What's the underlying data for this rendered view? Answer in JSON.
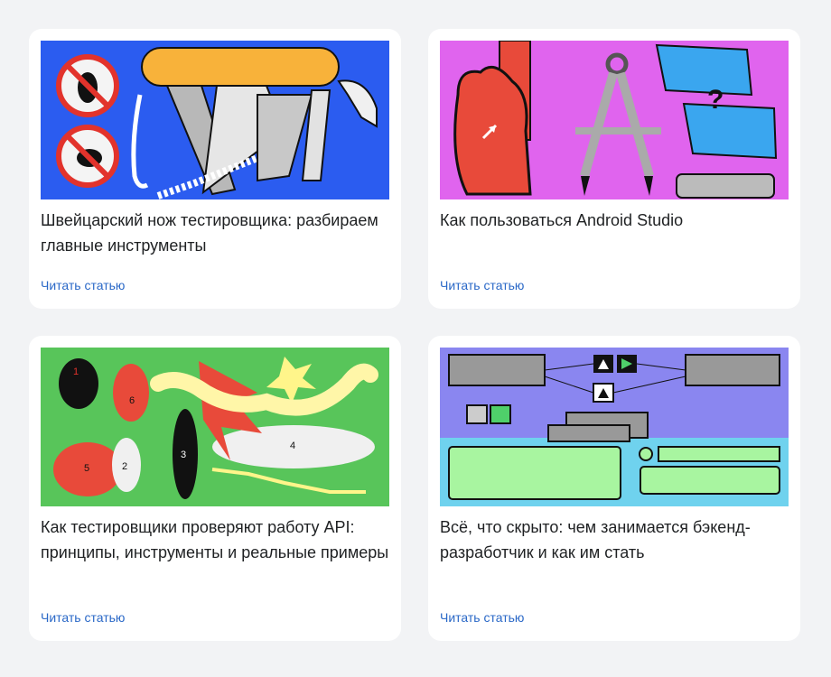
{
  "cards": [
    {
      "title": "Швейцарский нож тестировщика: разбираем главные инструменты",
      "link": "Читать статью",
      "image": "swiss-knife-illustration"
    },
    {
      "title": "Как пользоваться Android Studio",
      "link": "Читать статью",
      "image": "android-studio-illustration"
    },
    {
      "title": "Как тестировщики проверяют работу API: принципы, инструменты и реальные примеры",
      "link": "Читать статью",
      "image": "api-testing-illustration"
    },
    {
      "title": "Всё, что скрыто: чем занимается бэкенд-разработчик и как им стать",
      "link": "Читать статью",
      "image": "backend-developer-illustration"
    }
  ],
  "illustration_labels": {
    "api": [
      "1",
      "2",
      "3",
      "4",
      "5",
      "6"
    ],
    "android_question": "?"
  },
  "colors": {
    "background": "#f2f3f5",
    "card": "#ffffff",
    "link": "#2a68c7",
    "title": "#1f2123",
    "art1_bg": "#2b5cf0",
    "art2_bg": "#e064ee",
    "art3_bg": "#58c55a",
    "art4_top": "#8a86f0",
    "art4_bottom": "#6fd2ee"
  }
}
